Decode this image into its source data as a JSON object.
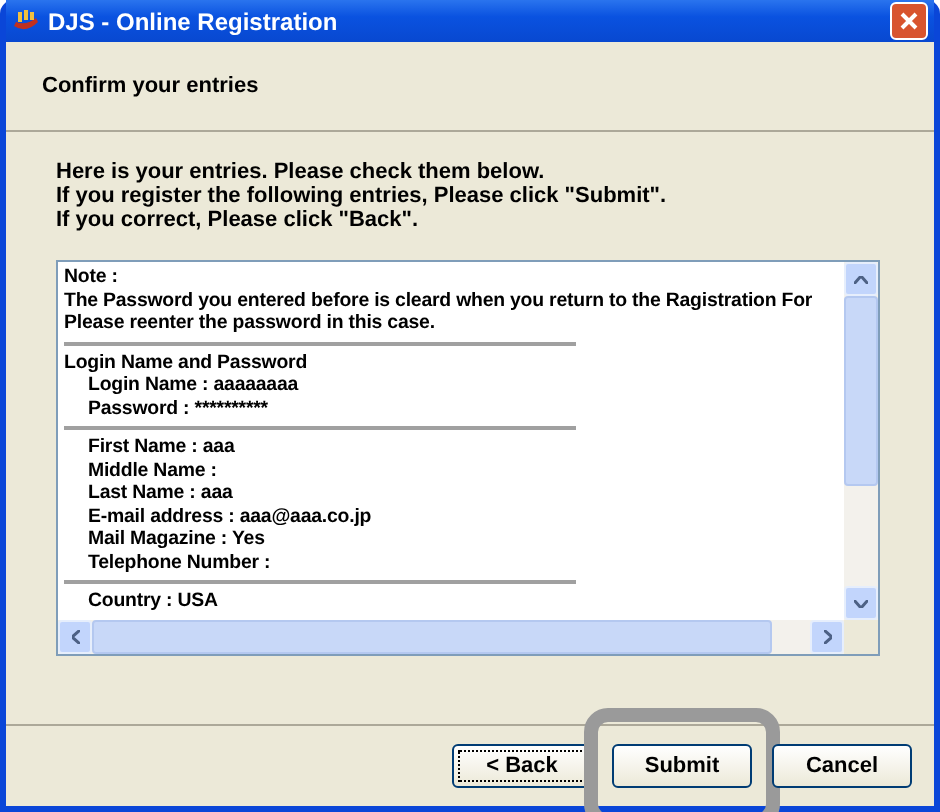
{
  "window": {
    "title": "DJS - Online Registration"
  },
  "header": {
    "title": "Confirm your entries"
  },
  "instructions": [
    "Here is your entries. Please check them below.",
    "If you register the following entries, Please click \"Submit\".",
    "If you correct, Please click \"Back\"."
  ],
  "entries": [
    {
      "kind": "note",
      "lines": [
        "Note :",
        "The Password you entered before is cleard when you return to the Ragistration For",
        "Please reenter the password in this case."
      ]
    },
    {
      "kind": "group",
      "heading": "Login Name and Password",
      "lines": [
        "Login Name : aaaaaaaa",
        "Password : **********"
      ]
    },
    {
      "kind": "group",
      "lines": [
        "First Name : aaa",
        "Middle Name :",
        "Last Name : aaa",
        "E-mail address : aaa@aaa.co.jp",
        "Mail Magazine : Yes",
        "Telephone Number :"
      ]
    },
    {
      "kind": "group",
      "lines": [
        "Country : USA"
      ]
    }
  ],
  "buttons": [
    {
      "label": "< Back",
      "focused": true,
      "highlighted": false
    },
    {
      "label": "Submit",
      "focused": false,
      "highlighted": true
    },
    {
      "label": "Cancel",
      "focused": false,
      "highlighted": false
    }
  ]
}
